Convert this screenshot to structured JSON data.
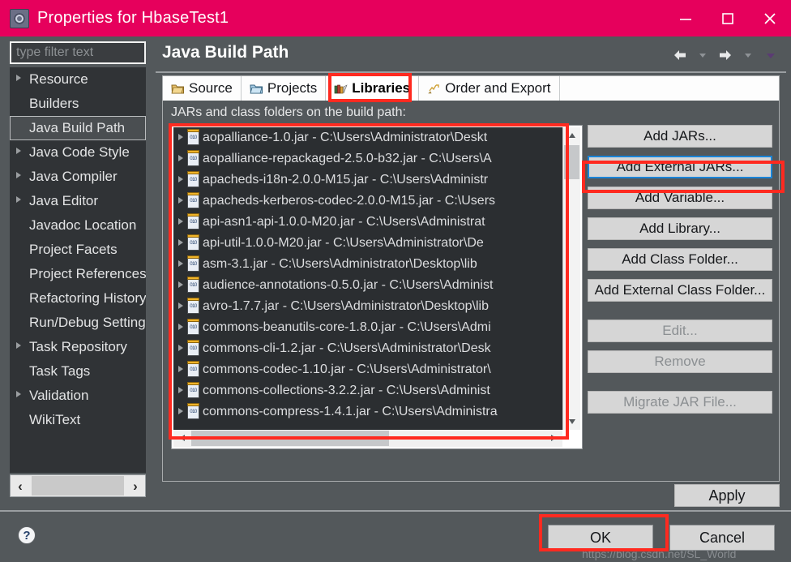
{
  "window": {
    "title": "Properties for HbaseTest1",
    "icon": "properties-gear-icon",
    "accent_color": "#e6005c",
    "body_color": "#53585b",
    "controls": {
      "minimize": "—",
      "maximize": "□",
      "close": "✕"
    }
  },
  "sidebar": {
    "filter": {
      "placeholder": "type filter text",
      "value": ""
    },
    "items": [
      {
        "label": "Resource",
        "expandable": true,
        "selected": false
      },
      {
        "label": "Builders",
        "expandable": false,
        "selected": false
      },
      {
        "label": "Java Build Path",
        "expandable": false,
        "selected": true
      },
      {
        "label": "Java Code Style",
        "expandable": true,
        "selected": false
      },
      {
        "label": "Java Compiler",
        "expandable": true,
        "selected": false
      },
      {
        "label": "Java Editor",
        "expandable": true,
        "selected": false
      },
      {
        "label": "Javadoc Location",
        "expandable": false,
        "selected": false
      },
      {
        "label": "Project Facets",
        "expandable": false,
        "selected": false
      },
      {
        "label": "Project References",
        "expandable": false,
        "selected": false
      },
      {
        "label": "Refactoring History",
        "expandable": false,
        "selected": false
      },
      {
        "label": "Run/Debug Settings",
        "expandable": false,
        "selected": false
      },
      {
        "label": "Task Repository",
        "expandable": true,
        "selected": false
      },
      {
        "label": "Task Tags",
        "expandable": false,
        "selected": false
      },
      {
        "label": "Validation",
        "expandable": true,
        "selected": false
      },
      {
        "label": "WikiText",
        "expandable": false,
        "selected": false
      }
    ],
    "hscroll": {
      "left_arrow": "‹",
      "right_arrow": "›"
    }
  },
  "page": {
    "title": "Java Build Path",
    "nav": {
      "back_icon": "arrow-left-icon",
      "back_menu_icon": "chevron-down-icon",
      "forward_icon": "arrow-right-icon",
      "forward_menu_icon": "chevron-down-icon",
      "view_menu_icon": "chevron-down-icon"
    }
  },
  "tabs": [
    {
      "label": "Source",
      "icon": "source-folder-icon",
      "active": false
    },
    {
      "label": "Projects",
      "icon": "projects-folder-icon",
      "active": false
    },
    {
      "label": "Libraries",
      "icon": "libraries-books-icon",
      "active": true
    },
    {
      "label": "Order and Export",
      "icon": "order-export-icon",
      "active": false
    }
  ],
  "libraries_panel": {
    "label": "JARs and class folders on the build path:",
    "entries": [
      "aopalliance-1.0.jar - C:\\Users\\Administrator\\Deskt",
      "aopalliance-repackaged-2.5.0-b32.jar - C:\\Users\\A",
      "apacheds-i18n-2.0.0-M15.jar - C:\\Users\\Administr",
      "apacheds-kerberos-codec-2.0.0-M15.jar - C:\\Users",
      "api-asn1-api-1.0.0-M20.jar - C:\\Users\\Administrat",
      "api-util-1.0.0-M20.jar - C:\\Users\\Administrator\\De",
      "asm-3.1.jar - C:\\Users\\Administrator\\Desktop\\lib",
      "audience-annotations-0.5.0.jar - C:\\Users\\Administ",
      "avro-1.7.7.jar - C:\\Users\\Administrator\\Desktop\\lib",
      "commons-beanutils-core-1.8.0.jar - C:\\Users\\Admi",
      "commons-cli-1.2.jar - C:\\Users\\Administrator\\Desk",
      "commons-codec-1.10.jar - C:\\Users\\Administrator\\",
      "commons-collections-3.2.2.jar - C:\\Users\\Administ",
      "commons-compress-1.4.1.jar - C:\\Users\\Administra"
    ],
    "entry_icon": "jar-file-icon",
    "vscroll": {
      "up_arrow": "▲",
      "down_arrow": "▼"
    },
    "hscroll": {
      "left_arrow": "◀",
      "right_arrow": "▶"
    }
  },
  "actions": [
    {
      "label": "Add JARs...",
      "enabled": true,
      "focused": false
    },
    {
      "label": "Add External JARs...",
      "enabled": true,
      "focused": true
    },
    {
      "label": "Add Variable...",
      "enabled": true,
      "focused": false
    },
    {
      "label": "Add Library...",
      "enabled": true,
      "focused": false
    },
    {
      "label": "Add Class Folder...",
      "enabled": true,
      "focused": false
    },
    {
      "label": "Add External Class Folder...",
      "enabled": true,
      "focused": false
    },
    {
      "label": "Edit...",
      "enabled": false,
      "focused": false
    },
    {
      "label": "Remove",
      "enabled": false,
      "focused": false
    },
    {
      "label": "Migrate JAR File...",
      "enabled": false,
      "focused": false
    }
  ],
  "footer": {
    "apply_label": "Apply",
    "ok_label": "OK",
    "cancel_label": "Cancel",
    "help_icon": "help-question-icon",
    "help_glyph": "?",
    "watermark": "https://blog.csdn.net/SL_World"
  },
  "annotations": {
    "highlight_color": "#ff2a20",
    "boxes": [
      "libraries-tab",
      "jar-list",
      "add-external-jars-button",
      "ok-button"
    ]
  }
}
